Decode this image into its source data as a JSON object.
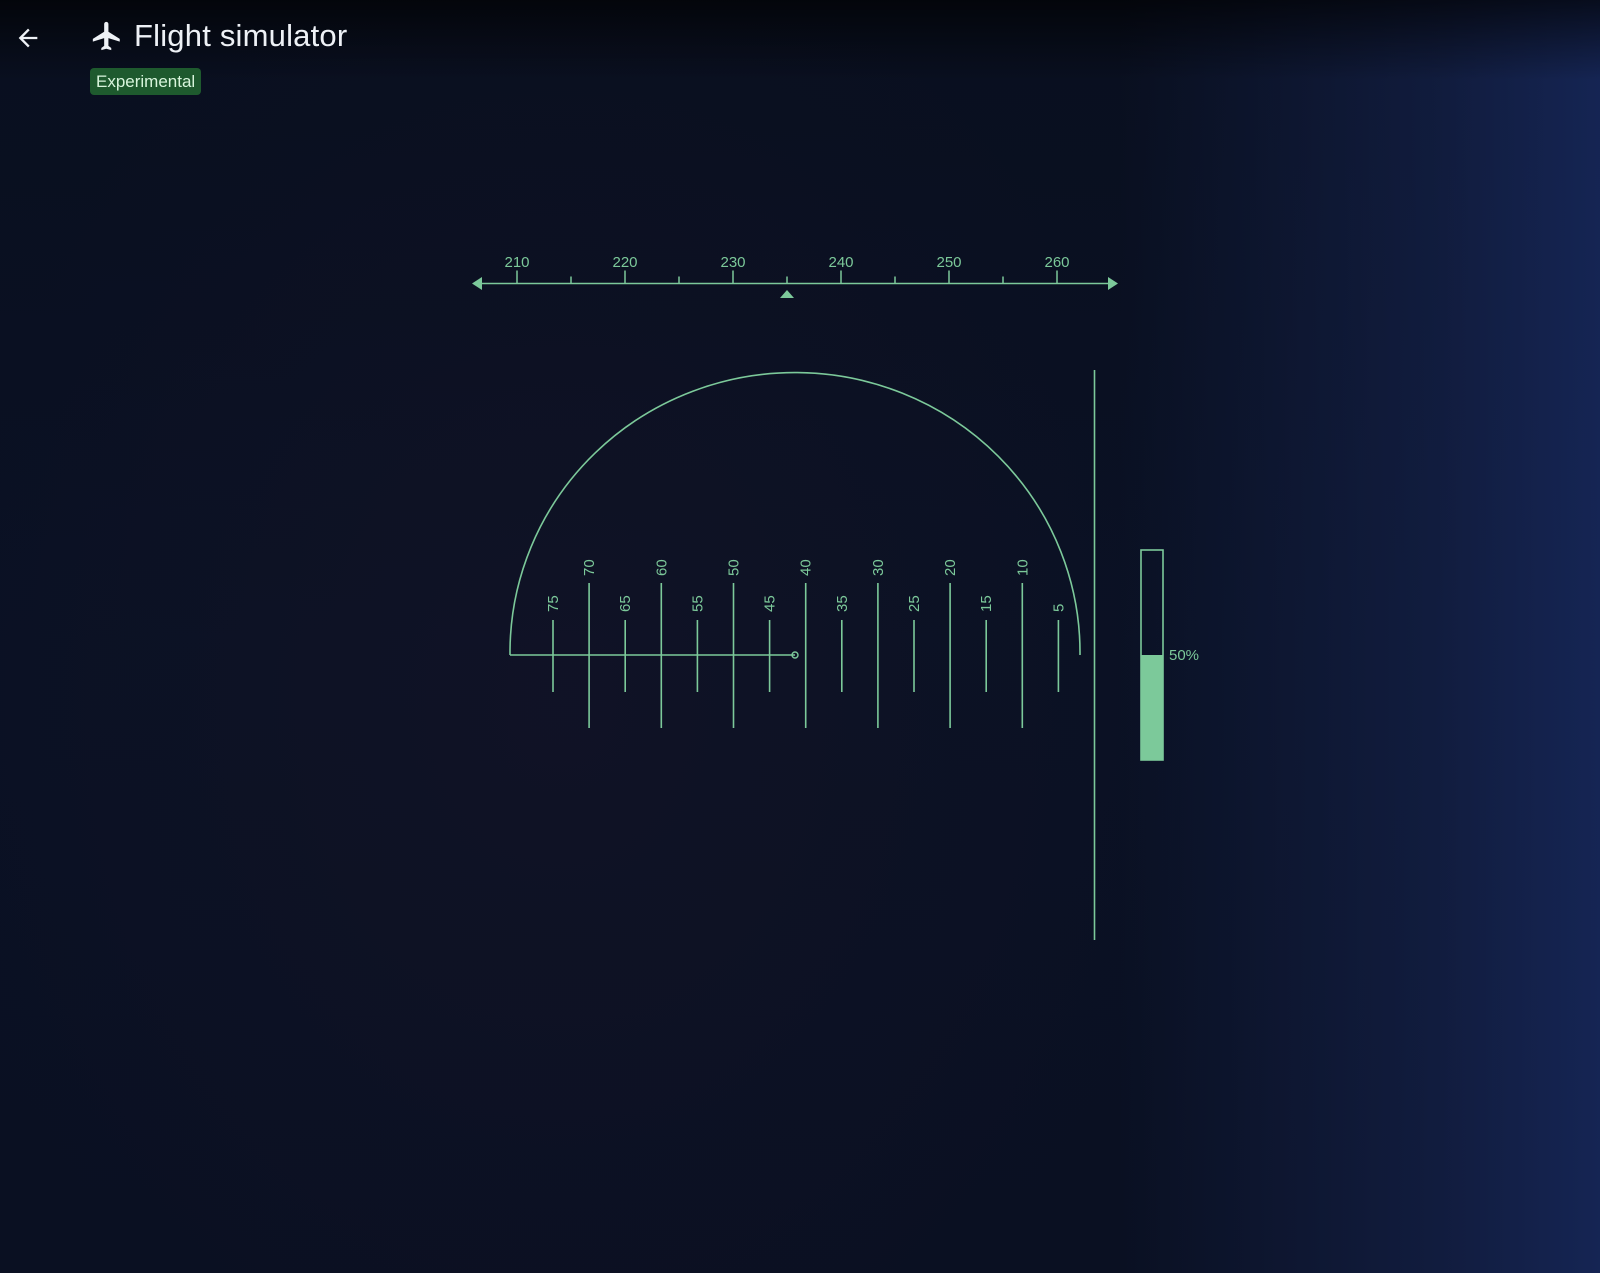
{
  "header": {
    "title": "Flight simulator",
    "badge": "Experimental",
    "icons": {
      "back": "arrow-back-icon",
      "app": "airplane-icon"
    }
  },
  "hud": {
    "accent_color": "#7cc99a",
    "heading": {
      "labels": [
        "210",
        "220",
        "230",
        "240",
        "250",
        "260"
      ],
      "values": [
        210,
        220,
        230,
        240,
        250,
        260
      ],
      "current": 235
    },
    "pitch_scale": {
      "labels": [
        "75",
        "70",
        "65",
        "60",
        "55",
        "50",
        "45",
        "40",
        "35",
        "30",
        "25",
        "20",
        "15",
        "10",
        "5"
      ]
    },
    "throttle": {
      "value": 0.5,
      "label": "50%"
    }
  }
}
